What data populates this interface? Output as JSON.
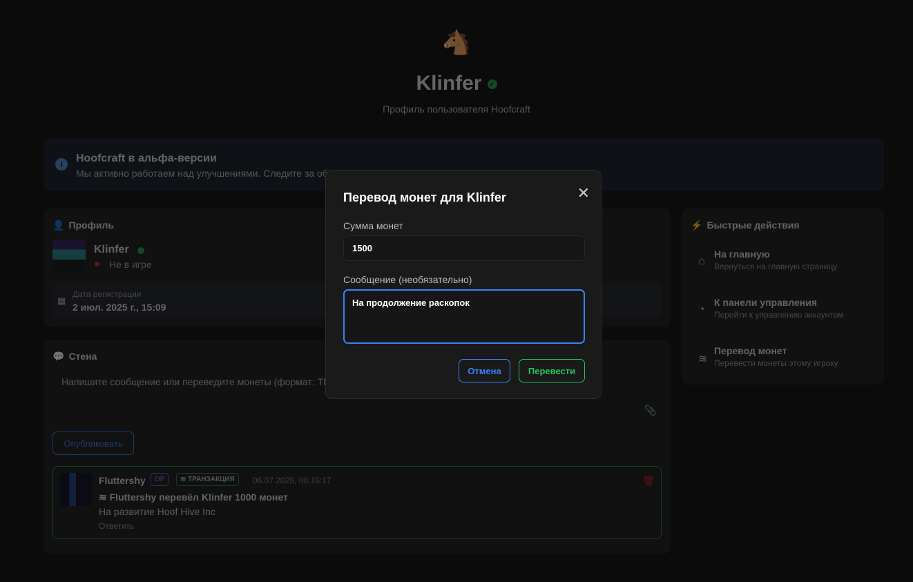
{
  "header": {
    "logo": "pony-logo",
    "title": "Klinfer",
    "subtitle": "Профиль пользователя Hoofcraft"
  },
  "alert": {
    "title": "Hoofcraft в альфа-версии",
    "text": "Мы активно работаем над улучшениями. Следите за обновлениями!"
  },
  "profile": {
    "section": "Профиль",
    "name": "Klinfer",
    "status": "Не в игре",
    "reg_label": "Дата регистрации",
    "reg_date": "2 июл. 2025 г., 15:09"
  },
  "wall": {
    "section": "Стена",
    "placeholder": "Напишите сообщение или переведите монеты (формат: TRANSACTION: сумма сообщение)",
    "publish": "Опубликовать",
    "posts": [
      {
        "author": "Fluttershy",
        "op_badge": "OP",
        "tx_badge": "ТРАНЗАКЦИЯ",
        "time": "06.07.2025, 00:15:17",
        "title": "Fluttershy перевёл Klinfer 1000 монет",
        "message": "На развитие Hoof Hive Inc",
        "reply": "Ответить"
      }
    ]
  },
  "quick": {
    "section": "Быстрые действия",
    "items": [
      {
        "title": "На главную",
        "desc": "Вернуться на главную страницу",
        "icon": "home-icon"
      },
      {
        "title": "К панели управления",
        "desc": "Перейти к управлению аккаунтом",
        "icon": "dashboard-icon"
      },
      {
        "title": "Перевод монет",
        "desc": "Перевести монеты этому игроку",
        "icon": "coins-icon"
      }
    ]
  },
  "modal": {
    "title": "Перевод монет для Klinfer",
    "amount_label": "Сумма монет",
    "amount": "1500",
    "message_label": "Сообщение (необязательно)",
    "message": "На продолжение раскопок",
    "cancel": "Отмена",
    "submit": "Перевести"
  },
  "colors": {
    "accent": "#3b82f6",
    "success": "#22c55e",
    "danger": "#dc2626"
  }
}
